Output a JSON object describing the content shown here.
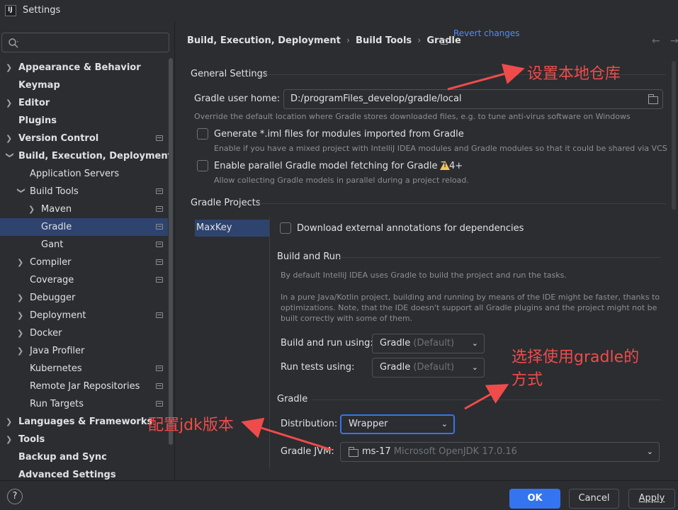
{
  "window": {
    "title": "Settings"
  },
  "sidebar": {
    "items": [
      {
        "label": "Appearance & Behavior"
      },
      {
        "label": "Keymap"
      },
      {
        "label": "Editor"
      },
      {
        "label": "Plugins"
      },
      {
        "label": "Version Control"
      },
      {
        "label": "Build, Execution, Deployment"
      },
      {
        "label": "Application Servers"
      },
      {
        "label": "Build Tools"
      },
      {
        "label": "Maven"
      },
      {
        "label": "Gradle"
      },
      {
        "label": "Gant"
      },
      {
        "label": "Compiler"
      },
      {
        "label": "Coverage"
      },
      {
        "label": "Debugger"
      },
      {
        "label": "Deployment"
      },
      {
        "label": "Docker"
      },
      {
        "label": "Java Profiler"
      },
      {
        "label": "Kubernetes"
      },
      {
        "label": "Remote Jar Repositories"
      },
      {
        "label": "Run Targets"
      },
      {
        "label": "Languages & Frameworks"
      },
      {
        "label": "Tools"
      },
      {
        "label": "Backup and Sync"
      },
      {
        "label": "Advanced Settings"
      }
    ]
  },
  "header": {
    "breadcrumb": [
      "Build, Execution, Deployment",
      "Build Tools",
      "Gradle"
    ],
    "revert": "Revert changes"
  },
  "general": {
    "title": "General Settings",
    "user_home_label": "Gradle user home:",
    "user_home_value": "D:/programFiles_develop/gradle/local",
    "user_home_hint": "Override the default location where Gradle stores downloaded files, e.g. to tune anti-virus software on Windows",
    "iml_label": "Generate *.iml files for modules imported from Gradle",
    "iml_hint": "Enable if you have a mixed project with IntelliJ IDEA modules and Gradle modules so that it could be shared via VCS",
    "parallel_label": "Enable parallel Gradle model fetching for Gradle 7.4+",
    "parallel_hint": "Allow collecting Gradle models in parallel during a project reload."
  },
  "projects": {
    "title": "Gradle Projects",
    "list": [
      "MaxKey"
    ],
    "download_annotations": "Download external annotations for dependencies",
    "build_and_run": {
      "title": "Build and Run",
      "hint1": "By default IntelliJ IDEA uses Gradle to build the project and run the tasks.",
      "hint2": "In a pure Java/Kotlin project, building and running by means of the IDE might be faster, thanks to optimizations. Note, that the IDE doesn't support all Gradle plugins and the project might not be built correctly with some of them.",
      "build_run_label": "Build and run using:",
      "build_run_value": "Gradle",
      "build_run_suffix": "(Default)",
      "run_tests_label": "Run tests using:",
      "run_tests_value": "Gradle",
      "run_tests_suffix": "(Default)"
    },
    "gradle": {
      "title": "Gradle",
      "distribution_label": "Distribution:",
      "distribution_value": "Wrapper",
      "jvm_label": "Gradle JVM:",
      "jvm_value": "ms-17",
      "jvm_detail": "Microsoft OpenJDK 17.0.16"
    }
  },
  "footer": {
    "ok": "OK",
    "cancel": "Cancel",
    "apply": "Apply",
    "help": "?"
  },
  "annotations": {
    "local_repo": "设置本地仓库",
    "gradle_mode_line1": "选择使用gradle的",
    "gradle_mode_line2": "方式",
    "jdk_version": "配置jdk版本",
    "color": "#ef4b4b"
  },
  "colors": {
    "accent": "#3574f0",
    "selection": "#2e436e",
    "background": "#2b2d30",
    "warning": "#f2c55c"
  }
}
